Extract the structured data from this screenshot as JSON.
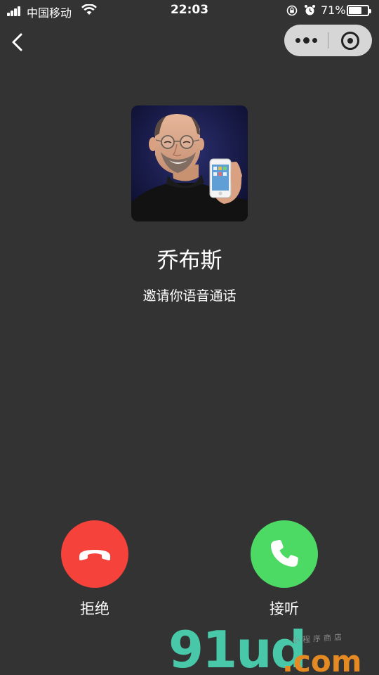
{
  "status_bar": {
    "carrier": "中国移动",
    "time": "22:03",
    "battery_percent": "71%",
    "battery_level": 0.71
  },
  "nav": {
    "back_icon": "chevron-left-icon",
    "capsule": {
      "more_icon": "more-dots-icon",
      "close_icon": "target-circle-icon"
    }
  },
  "caller": {
    "name": "乔布斯",
    "subtitle": "邀请你语音通话"
  },
  "actions": {
    "decline_label": "拒绝",
    "accept_label": "接听"
  },
  "colors": {
    "background": "#333333",
    "decline": "#f5423b",
    "accept": "#4cd964"
  },
  "watermark": {
    "main": "91ud",
    "suffix": ".com",
    "tagline": "小程序商店"
  }
}
